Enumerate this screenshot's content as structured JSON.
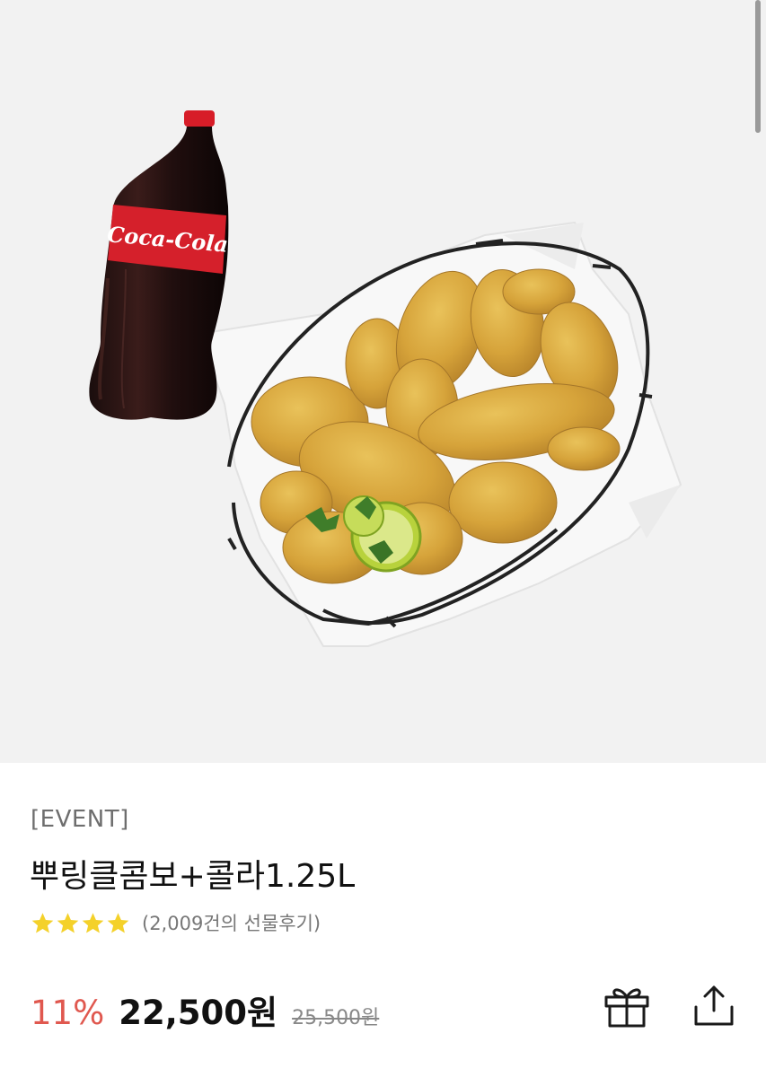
{
  "product": {
    "tag": "[EVENT]",
    "name": "뿌링클콤보+콜라1.25L",
    "rating_stars": 4,
    "review_text": "(2,009건의 선물후기)",
    "discount": "11%",
    "price": "22,500원",
    "original_price": "25,500원",
    "image_label": "Coca-Cola"
  },
  "colors": {
    "discount": "#e0584f",
    "star": "#f4d12a",
    "hero_bg": "#f2f2f2"
  },
  "icons": [
    "star-icon",
    "gift-icon",
    "share-icon"
  ]
}
